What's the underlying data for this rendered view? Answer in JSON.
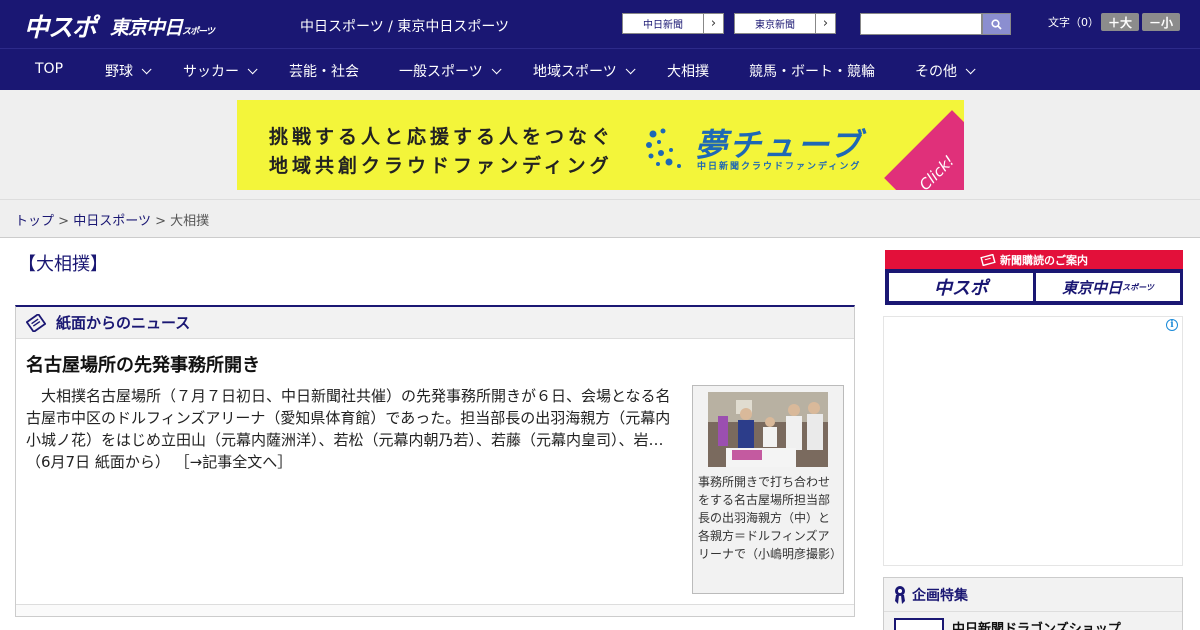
{
  "header": {
    "logo_chuspo": "中スポ",
    "logo_tokyo": "東京中日",
    "logo_tokyo_sub": "スポーツ",
    "site_names": "中日スポーツ / 東京中日スポーツ",
    "ext_links": [
      {
        "label": "中日新聞"
      },
      {
        "label": "東京新聞"
      }
    ],
    "search": {
      "value": "",
      "placeholder": ""
    },
    "fontsize_label": "文字（0）",
    "font_larger": "＋大",
    "font_smaller": "－小"
  },
  "nav": {
    "items": [
      {
        "label": "TOP"
      },
      {
        "label": "野球"
      },
      {
        "label": "サッカー"
      },
      {
        "label": "芸能・社会"
      },
      {
        "label": "一般スポーツ"
      },
      {
        "label": "地域スポーツ"
      },
      {
        "label": "大相撲"
      },
      {
        "label": "競馬・ボート・競輪"
      },
      {
        "label": "その他"
      }
    ]
  },
  "banner": {
    "line1": "挑戦する人と応援する人をつなぐ",
    "line2": "地域共創クラウドファンディング",
    "brand": "夢チューブ",
    "brand_sub": "中日新聞クラウドファンディング",
    "click": "Click!"
  },
  "breadcrumb": {
    "top": "トップ",
    "sep": ">",
    "section": "中日スポーツ",
    "current": "大相撲"
  },
  "main": {
    "category_title": "【大相撲】",
    "news_heading": "紙面からのニュース",
    "article_title": "名古屋場所の先発事務所開き",
    "article_body": "大相撲名古屋場所（７月７日初日、中日新聞社共催）の先発事務所開きが６日、会場となる名古屋市中区のドルフィンズアリーナ（愛知県体育館）であった。担当部長の出羽海親方（元幕内小城ノ花）をはじめ立田山（元幕内薩洲洋）、若松（元幕内朝乃若）、若藤（元幕内皇司）、岩…（6月7日 紙面から）",
    "read_more": "［→記事全文へ］",
    "photo_caption": "事務所開きで打ち合わせをする名古屋場所担当部長の出羽海親方（中）と各親方＝ドルフィンズアリーナで（小嶋明彦撮影）"
  },
  "sidebar": {
    "subscription_title": "新聞購読のご案内",
    "sub_chuspo": "中スポ",
    "sub_tokyo": "東京中日",
    "sub_tokyo_small": "スポーツ",
    "ad_info": "i",
    "feature_heading": "企画特集",
    "feature_item": "中日新聞ドラゴンズショップ"
  },
  "colors": {
    "brand_navy": "#1a1773",
    "banner_yellow": "#f3f53a",
    "banner_blue": "#1e68b5",
    "banner_pink": "#e0307a",
    "subscription_red": "#e3103a"
  }
}
